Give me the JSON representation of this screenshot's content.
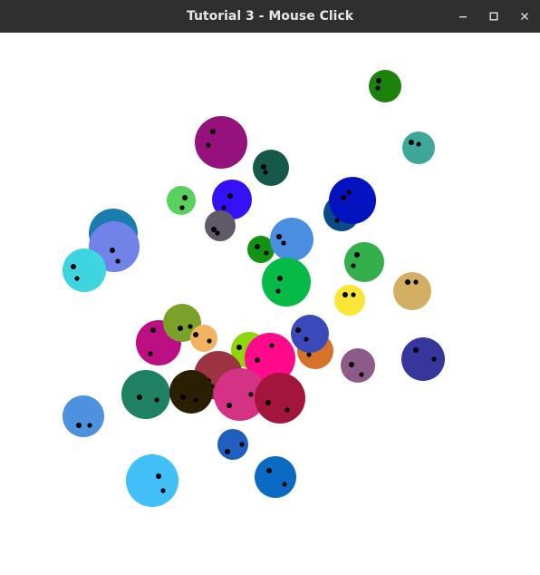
{
  "window": {
    "title": "Tutorial 3 - Mouse Click",
    "controls": {
      "minimize_icon": "minimize-icon",
      "maximize_icon": "maximize-icon",
      "close_icon": "close-icon"
    },
    "titlebar_color": "#2f2f2f",
    "canvas_color": "#ffffff"
  },
  "scene": {
    "eye_color": "#000000",
    "ball_colors": [
      "#1b820b",
      "#3da79a",
      "#95127c",
      "#16584a",
      "#5ad15d",
      "#3511f5",
      "#0a4a86",
      "#0413c0",
      "#625968",
      "#1b7caf",
      "#7182e8",
      "#3ed5e1",
      "#129412",
      "#4a8ee2",
      "#33af4b",
      "#06ba48",
      "#fbe637",
      "#d3af63",
      "#d6732b",
      "#3b4ab9",
      "#bc0f84",
      "#7ba12a",
      "#f3b360",
      "#8fd60e",
      "#ff0a8a",
      "#9d3441",
      "#d43285",
      "#a4153c",
      "#1e8162",
      "#291f03",
      "#8d5b89",
      "#36369c",
      "#4c92df",
      "#1f5fc0",
      "#41bff7",
      "#0b6ac3"
    ]
  }
}
